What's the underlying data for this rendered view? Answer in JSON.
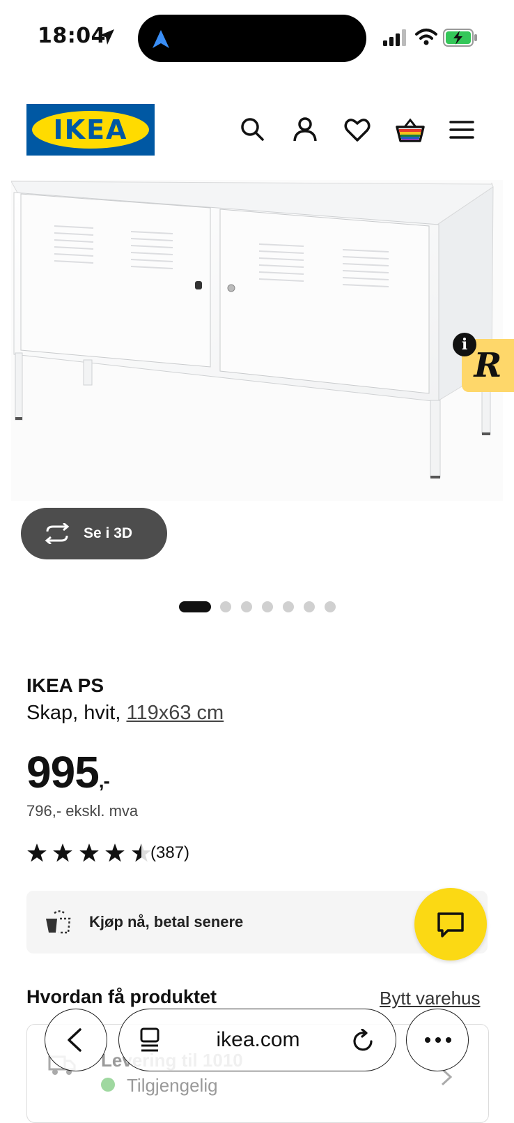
{
  "status_bar": {
    "time": "18:04"
  },
  "header": {
    "logo_text": "IKEA",
    "icons": [
      "search-icon",
      "user-icon",
      "heart-icon",
      "basket-icon",
      "menu-icon"
    ]
  },
  "gallery": {
    "view_3d_label": "Se i 3D",
    "info_badge": "i",
    "r_badge": "R",
    "dots_total": 7,
    "dots_active": 1
  },
  "product": {
    "name": "IKEA PS",
    "description": "Skap, hvit, ",
    "size": "119x63 cm",
    "price_main": "995",
    "price_suffix": ",-",
    "price_ex_vat": "796,- ekskl. mva",
    "rating": 4.5,
    "review_count": "(387)"
  },
  "pay_later": {
    "label": "Kjøp nå, betal senere"
  },
  "delivery": {
    "heading": "Hvordan få produktet",
    "change_store": "Bytt varehus",
    "option_title": "Levering til 1010",
    "option_status": "Tilgjengelig"
  },
  "browser": {
    "url": "ikea.com"
  },
  "colors": {
    "ikea_blue": "#0058a3",
    "ikea_yellow": "#ffdb00",
    "chat_yellow": "#fbd914",
    "button_dark": "#4d4d4d"
  }
}
